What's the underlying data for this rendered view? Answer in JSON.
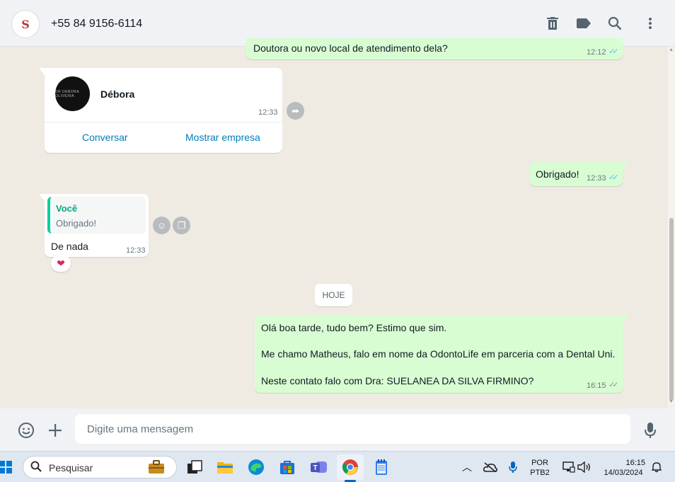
{
  "header": {
    "avatar_text": "S",
    "contact_name": "+55 84 9156-6114",
    "icons": [
      "trash-icon",
      "label-icon",
      "search-icon",
      "menu-icon"
    ]
  },
  "messages": {
    "m1": {
      "text": "Doutora ou novo local de atendimento dela?",
      "time": "12:12"
    },
    "card": {
      "name": "Débora",
      "time": "12:33",
      "action_chat": "Conversar",
      "action_business": "Mostrar empresa"
    },
    "m2": {
      "text": "Obrigado!",
      "time": "12:33"
    },
    "m3": {
      "quote_author": "Você",
      "quote_text": "Obrigado!",
      "text": "De nada",
      "time": "12:33",
      "reaction": "❤"
    },
    "date_chip": "HOJE",
    "m4": {
      "line1": "Olá boa tarde, tudo bem? Estimo que sim.",
      "line2": "Me chamo Matheus, falo em nome da OdontoLife em parceria com a Dental Uni.",
      "line3": "Neste contato falo com Dra: SUELANEA DA SILVA FIRMINO?",
      "time": "16:15"
    }
  },
  "composer": {
    "placeholder": "Digite uma mensagem"
  },
  "taskbar": {
    "search_label": "Pesquisar",
    "lang_line1": "POR",
    "lang_line2": "PTB2",
    "time": "16:15",
    "date": "14/03/2024"
  },
  "colors": {
    "outgoing_bubble": "#d9fdd3",
    "chat_bg": "#efeae2",
    "link": "#027eb5",
    "read_ticks": "#53bdeb"
  }
}
